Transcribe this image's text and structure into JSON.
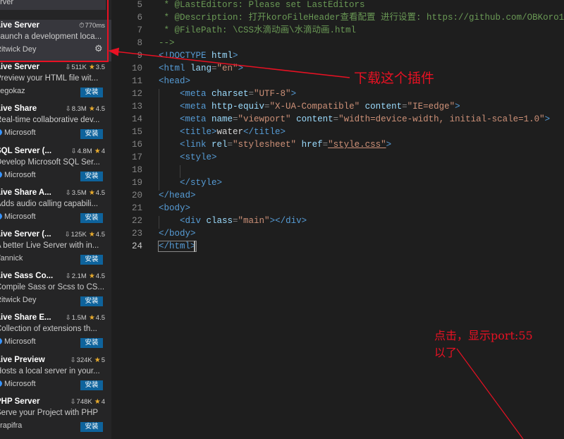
{
  "sidebar": {
    "top_fragment": "erver",
    "extensions": [
      {
        "name": "Live Server",
        "duration": "770ms",
        "description": "Launch a development loca...",
        "publisher": "Ritwick Dey",
        "installed": true
      },
      {
        "name": "Live Server",
        "downloads": "511K",
        "rating": "3.5",
        "description": "Preview your HTML file wit...",
        "publisher": "negokaz",
        "install_label": "安装"
      },
      {
        "name": "Live Share",
        "downloads": "8.3M",
        "rating": "4.5",
        "description": "Real-time collaborative dev...",
        "publisher": "Microsoft",
        "verified": true,
        "install_label": "安装"
      },
      {
        "name": "SQL Server (...",
        "downloads": "4.8M",
        "rating": "4",
        "description": "Develop Microsoft SQL Ser...",
        "publisher": "Microsoft",
        "verified": true,
        "install_label": "安装"
      },
      {
        "name": "Live Share A...",
        "downloads": "3.5M",
        "rating": "4.5",
        "description": "Adds audio calling capabili...",
        "publisher": "Microsoft",
        "verified": true,
        "install_label": "安装"
      },
      {
        "name": "Live Server (...",
        "downloads": "125K",
        "rating": "4.5",
        "description": "A better Live Server with in...",
        "publisher": "Yannick",
        "install_label": "安装"
      },
      {
        "name": "Live Sass Co...",
        "downloads": "2.1M",
        "rating": "4.5",
        "description": "Compile Sass or Scss to CS...",
        "publisher": "Ritwick Dey",
        "install_label": "安装"
      },
      {
        "name": "Live Share E...",
        "downloads": "1.5M",
        "rating": "4.5",
        "description": "Collection of extensions th...",
        "publisher": "Microsoft",
        "verified": true,
        "install_label": "安装"
      },
      {
        "name": "Live Preview",
        "downloads": "324K",
        "rating": "5",
        "description": "Hosts a local server in your...",
        "publisher": "Microsoft",
        "verified": true,
        "install_label": "安装"
      },
      {
        "name": "PHP Server",
        "downloads": "748K",
        "rating": "4",
        "description": "Serve your Project with PHP",
        "publisher": "brapifra",
        "install_label": "安装"
      }
    ]
  },
  "editor": {
    "line_numbers": [
      "5",
      "6",
      "7",
      "8",
      "9",
      "10",
      "11",
      "12",
      "13",
      "14",
      "15",
      "16",
      "17",
      "18",
      "19",
      "20",
      "21",
      "22",
      "23",
      "24"
    ],
    "active_line": "24",
    "lines": {
      "l5": " * @LastEditors: Please set LastEditors",
      "l6": " * @Description: 打开koroFileHeader查看配置 进行设置: https://github.com/OBKoro1",
      "l7": " * @FilePath: \\CSS水滴动画\\水滴动画.html",
      "l8": "-->",
      "l9_doctype": "<!DOCTYPE",
      "l9_html": " html",
      "l10_tag": "<html",
      "l10_attr": " lang",
      "l10_val": "\"en\"",
      "l11_tag": "<head>",
      "l12_tag": "<meta",
      "l12_attr": " charset",
      "l12_val": "\"UTF-8\"",
      "l13_tag": "<meta",
      "l13_attr": " http-equiv",
      "l13_val": "\"X-UA-Compatible\"",
      "l13_attr2": " content",
      "l13_val2": "\"IE=edge\"",
      "l14_tag": "<meta",
      "l14_attr": " name",
      "l14_val": "\"viewport\"",
      "l14_attr2": " content",
      "l14_val2": "\"width=device-width, initial-scale=1.0\"",
      "l15_open": "<title>",
      "l15_text": "water",
      "l15_close": "</title>",
      "l16_tag": "<link",
      "l16_attr": " rel",
      "l16_val": "\"stylesheet\"",
      "l16_attr2": " href",
      "l16_val2": "\"style.css\"",
      "l17_tag": "<style>",
      "l19_tag": "</style>",
      "l20_tag": "</head>",
      "l21_tag": "<body>",
      "l22_tag": "<div",
      "l22_attr": " class",
      "l22_val": "\"main\"",
      "l22_close": "></div>",
      "l23_tag": "</body>",
      "l24_tag": "</html>"
    }
  },
  "annotations": {
    "download_note": "下载这个插件",
    "click_note_line1": "点击，显示port:55",
    "click_note_line2": "以了"
  },
  "colors": {
    "annotation": "#e81123",
    "install_button": "#0e639c",
    "star": "#e8ab2d"
  }
}
